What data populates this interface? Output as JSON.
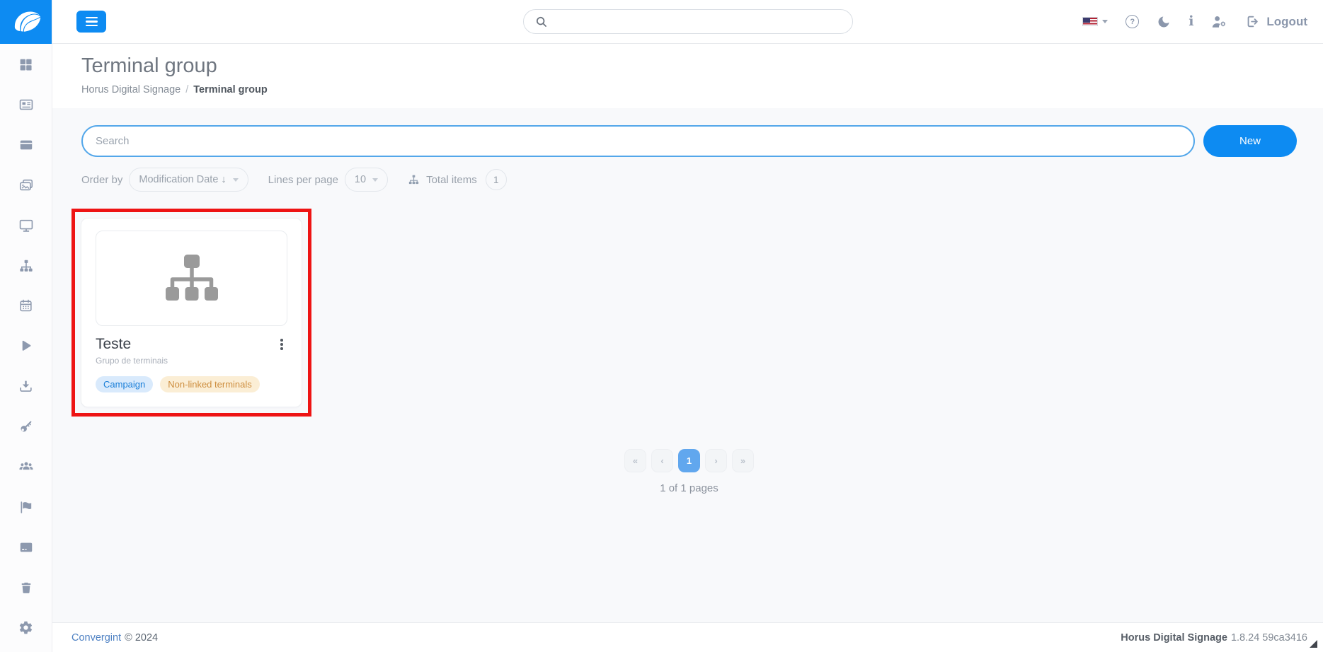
{
  "topbar": {
    "logout_label": "Logout",
    "search_value": "",
    "icons": [
      "menu-icon",
      "search-icon",
      "us-flag-icon",
      "caret-down-icon",
      "help-icon",
      "moon-icon",
      "info-icon",
      "user-settings-icon",
      "logout-icon"
    ]
  },
  "sidebar": {
    "icons": [
      "dashboard-icon",
      "news-icon",
      "panel-icon",
      "media-icon",
      "monitor-icon",
      "terminal-group-icon",
      "calendar-icon",
      "play-icon",
      "download-icon",
      "key-icon",
      "users-icon",
      "flag-icon",
      "card-icon",
      "trash-icon",
      "settings-icon"
    ]
  },
  "page": {
    "title": "Terminal group",
    "breadcrumb": {
      "parent": "Horus Digital Signage",
      "separator": "/",
      "current": "Terminal group"
    }
  },
  "toolbar": {
    "search_placeholder": "Search",
    "new_label": "New"
  },
  "filters": {
    "order_by_label": "Order by",
    "order_by_value": "Modification Date ↓",
    "lines_label": "Lines per page",
    "lines_value": "10",
    "total_label": "Total items",
    "total_value": "1"
  },
  "card": {
    "title": "Teste",
    "subtitle": "Grupo de terminais",
    "thumb_icon": "terminal-group-icon",
    "badges": [
      {
        "label": "Campaign",
        "bg": "#d9eafc",
        "color": "#1a7fd8"
      },
      {
        "label": "Non-linked terminals",
        "bg": "#fbeed5",
        "color": "#cd8d3d"
      }
    ]
  },
  "pagination": {
    "first": "«",
    "prev": "‹",
    "page": "1",
    "next": "›",
    "last": "»",
    "summary": "1 of 1 pages"
  },
  "footer": {
    "company": "Convergint",
    "copyright": "© 2024",
    "product": "Horus Digital Signage",
    "version": "1.8.24 59ca3416"
  },
  "colors": {
    "primary": "#0d8bf2",
    "active_page": "#61a7ee",
    "annotation_red": "#ee1414",
    "content_bg": "#f8f9fb"
  }
}
